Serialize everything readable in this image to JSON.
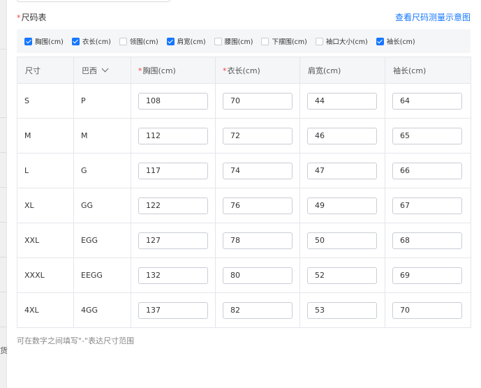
{
  "left_partial_char": "货",
  "title_required": "*",
  "title": "尺码表",
  "help_link": "查看尺码测量示意图",
  "checkboxes": [
    {
      "label": "胸围(cm)",
      "checked": true
    },
    {
      "label": "衣长(cm)",
      "checked": true
    },
    {
      "label": "领围(cm)",
      "checked": false
    },
    {
      "label": "肩宽(cm)",
      "checked": true
    },
    {
      "label": "腰围(cm)",
      "checked": false
    },
    {
      "label": "下摆围(cm)",
      "checked": false
    },
    {
      "label": "袖口大小(cm)",
      "checked": false
    },
    {
      "label": "袖长(cm)",
      "checked": true
    }
  ],
  "table": {
    "headers": [
      {
        "label": "尺寸",
        "required": ""
      },
      {
        "label": "巴西",
        "required": ""
      },
      {
        "label": "胸围(cm)",
        "required": "*"
      },
      {
        "label": "衣长(cm)",
        "required": "*"
      },
      {
        "label": "肩宽(cm)",
        "required": ""
      },
      {
        "label": "袖长(cm)",
        "required": ""
      }
    ],
    "rows": [
      {
        "size": "S",
        "region": "P",
        "chest": "108",
        "length": "70",
        "shoulder": "44",
        "sleeve": "64"
      },
      {
        "size": "M",
        "region": "M",
        "chest": "112",
        "length": "72",
        "shoulder": "46",
        "sleeve": "65"
      },
      {
        "size": "L",
        "region": "G",
        "chest": "117",
        "length": "74",
        "shoulder": "47",
        "sleeve": "66"
      },
      {
        "size": "XL",
        "region": "GG",
        "chest": "122",
        "length": "76",
        "shoulder": "49",
        "sleeve": "67"
      },
      {
        "size": "XXL",
        "region": "EGG",
        "chest": "127",
        "length": "78",
        "shoulder": "50",
        "sleeve": "68"
      },
      {
        "size": "XXXL",
        "region": "EEGG",
        "chest": "132",
        "length": "80",
        "shoulder": "52",
        "sleeve": "69"
      },
      {
        "size": "4XL",
        "region": "4GG",
        "chest": "137",
        "length": "82",
        "shoulder": "53",
        "sleeve": "70"
      }
    ]
  },
  "hint": "可在数字之间填写\"-\"表达尺寸范围",
  "colors": {
    "accent": "#1677ff",
    "required": "#f53f3f",
    "header_bg": "#f5f6f8",
    "border": "#e5e6eb"
  }
}
